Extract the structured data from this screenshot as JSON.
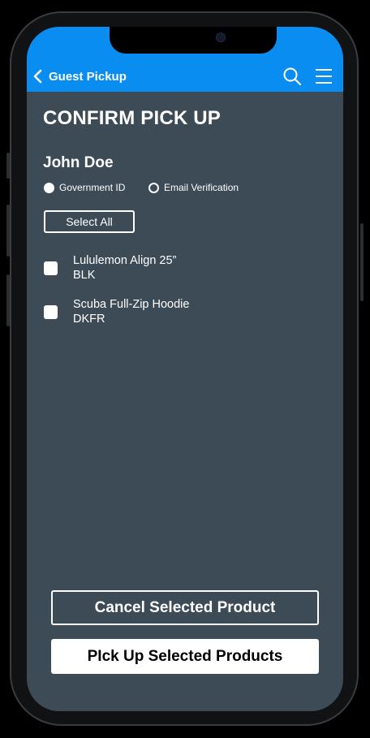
{
  "header": {
    "back_label": "Guest Pickup",
    "back_icon": "chevron-left-icon",
    "search_icon": "search-icon",
    "menu_icon": "hamburger-menu-icon",
    "background_color": "#0a8df0"
  },
  "page": {
    "title": "CONFIRM PICK UP",
    "background_color": "#3c4b56"
  },
  "customer": {
    "name": "John Doe"
  },
  "verification": {
    "options": [
      {
        "label": "Government ID",
        "selected": true
      },
      {
        "label": "Email Verification",
        "selected": false
      }
    ]
  },
  "select_all_label": "Select All",
  "products": [
    {
      "name": "Lululemon Align 25”",
      "color": "BLK",
      "checked": false
    },
    {
      "name": "Scuba Full-Zip Hoodie",
      "color": "DKFR",
      "checked": false
    }
  ],
  "actions": {
    "cancel_label": "Cancel Selected Product",
    "pickup_label": "PIck Up Selected Products"
  }
}
